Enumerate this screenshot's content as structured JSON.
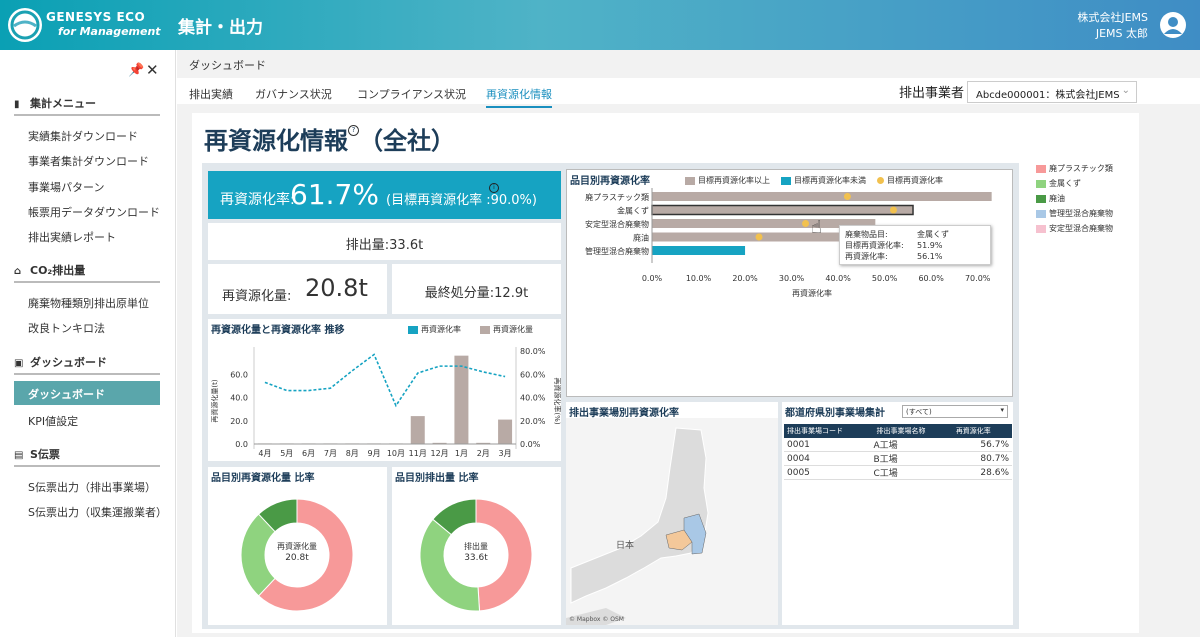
{
  "header": {
    "brand_line1": "GENESYS ECO",
    "brand_line2": "for Management",
    "title": "集計・出力",
    "company": "株式会社JEMS",
    "user": "JEMS 太郎"
  },
  "sidebar": {
    "sections": [
      {
        "title": "集計メニュー",
        "items": [
          "実績集計ダウンロード",
          "事業者集計ダウンロード",
          "事業場パターン",
          "帳票用データダウンロード",
          "排出実績レポート"
        ]
      },
      {
        "title": "CO₂排出量",
        "items": [
          "廃棄物種類別排出原単位",
          "改良トンキロ法"
        ]
      },
      {
        "title": "ダッシュボード",
        "items": [
          "ダッシュボード",
          "KPI値設定"
        ]
      },
      {
        "title": "S伝票",
        "items": [
          "S伝票出力（排出事業場）",
          "S伝票出力（収集運搬業者）"
        ]
      }
    ]
  },
  "breadcrumb": "ダッシュボード",
  "tabs": [
    "排出実績",
    "ガバナンス状況",
    "コンプライアンス状況",
    "再資源化情報"
  ],
  "emitter": {
    "label": "排出事業者",
    "value": "Abcde000001：株式会社JEMS"
  },
  "page_title": "再資源化情報",
  "page_scope": "（全社）",
  "kpi": {
    "rate_label": "再資源化率:",
    "rate_value": "61.7%",
    "target_text": "(目標再資源化率 :90.0%)",
    "emission": "排出量:33.6t",
    "recycle_label": "再資源化量:",
    "recycle_value": "20.8t",
    "final": "最終処分量:12.9t"
  },
  "colors": {
    "accent": "#16a3c2",
    "bar_gray": "#b8aaa5",
    "target_dot": "#f2c14e",
    "plastic": "#f79999",
    "metal": "#8fd37f",
    "oil": "#4a9a46",
    "mixed_ctrl": "#a9c8e6",
    "mixed_stable": "#f6c1cf"
  },
  "trend_chart": {
    "title": "再資源化量と再資源化率 推移",
    "legend_rate": "再資源化率",
    "legend_amount": "再資源化量",
    "ylabel_left": "再資源化量(t)",
    "ylabel_right": "再資源化率(%)",
    "months": [
      "4月",
      "5月",
      "6月",
      "7月",
      "8月",
      "9月",
      "10月",
      "11月",
      "12月",
      "1月",
      "2月",
      "3月"
    ],
    "left_ticks": [
      "60.0",
      "40.0",
      "20.0",
      "0.0"
    ],
    "right_ticks": [
      "80.0%",
      "60.0%",
      "40.0%",
      "20.0%",
      "0.0%"
    ]
  },
  "item_rate_chart": {
    "title": "品目別再資源化率",
    "legend_above": "目標再資源化率以上",
    "legend_below": "目標再資源化率未満",
    "legend_target": "目標再資源化率",
    "xlabel": "再資源化率",
    "xticks": [
      "0.0%",
      "10.0%",
      "20.0%",
      "30.0%",
      "40.0%",
      "50.0%",
      "60.0%",
      "70.0%"
    ],
    "tooltip": {
      "k1": "廃棄物品目:",
      "v1": "金属くず",
      "k2": "目標再資源化率:",
      "v2": "51.9%",
      "k3": "再資源化率:",
      "v3": "56.1%"
    }
  },
  "map_panel": {
    "title": "排出事業場別再資源化率",
    "country": "日本",
    "credit": "© Mapbox © OSM"
  },
  "pref_panel": {
    "title": "都道府県別事業場集計",
    "filter": "(すべて)",
    "columns": [
      "排出事業場コード",
      "排出事業場名称",
      "再資源化率"
    ],
    "rows": [
      [
        "0001",
        "A工場",
        "56.7%"
      ],
      [
        "0004",
        "B工場",
        "80.7%"
      ],
      [
        "0005",
        "C工場",
        "28.6%"
      ]
    ]
  },
  "donut_recycle": {
    "title": "品目別再資源化量 比率",
    "center_label": "再資源化量",
    "center_value": "20.8t"
  },
  "donut_emission": {
    "title": "品目別排出量 比率",
    "center_label": "排出量",
    "center_value": "33.6t"
  },
  "legend_items": [
    "廃プラスチック類",
    "金属くず",
    "廃油",
    "管理型混合廃棄物",
    "安定型混合廃棄物"
  ],
  "chart_data": [
    {
      "type": "bar",
      "title": "再資源化量と再資源化率 推移",
      "categories": [
        "4月",
        "5月",
        "6月",
        "7月",
        "8月",
        "9月",
        "10月",
        "11月",
        "12月",
        "1月",
        "2月",
        "3月"
      ],
      "series": [
        {
          "name": "再資源化量",
          "values": [
            0.5,
            0.5,
            0.5,
            0.5,
            0.5,
            0.5,
            0.5,
            24,
            1,
            76,
            1,
            21
          ]
        },
        {
          "name": "再資源化率",
          "values": [
            53,
            46,
            46,
            48,
            63,
            77,
            33,
            61,
            67,
            67,
            62,
            58
          ]
        }
      ],
      "ylim": [
        0,
        80
      ],
      "y2lim": [
        0,
        80
      ]
    },
    {
      "type": "bar",
      "title": "品目別再資源化率",
      "categories": [
        "廃プラスチック類",
        "金属くず",
        "安定型混合廃棄物",
        "廃油",
        "管理型混合廃棄物"
      ],
      "values": [
        73,
        56.1,
        48,
        42,
        20
      ],
      "targets": [
        42,
        51.9,
        33,
        23,
        null
      ],
      "xlim": [
        0,
        72
      ]
    },
    {
      "type": "pie",
      "title": "品目別再資源化量 比率",
      "categories": [
        "廃プラスチック類",
        "金属くず",
        "廃油"
      ],
      "values": [
        62,
        26,
        12
      ]
    },
    {
      "type": "pie",
      "title": "品目別排出量 比率",
      "categories": [
        "廃プラスチック類",
        "金属くず",
        "廃油"
      ],
      "values": [
        49,
        37,
        14
      ]
    }
  ]
}
